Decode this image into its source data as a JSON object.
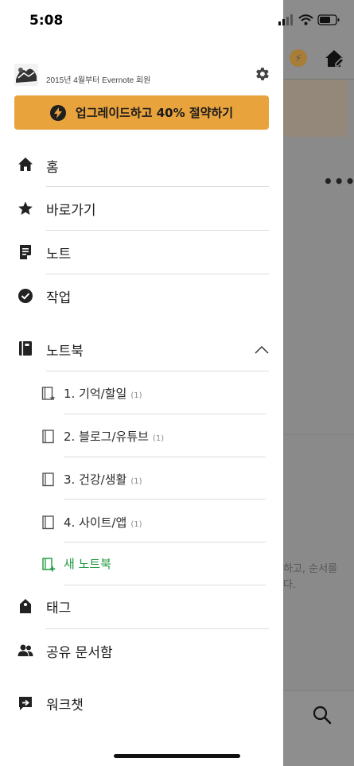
{
  "status": {
    "time": "5:08"
  },
  "profile": {
    "member_since": "2015년 4월부터 Evernote 회원"
  },
  "upgrade": {
    "label": "업그레이드하고 40% 절약하기"
  },
  "nav": {
    "home": "홈",
    "shortcuts": "바로가기",
    "notes": "노트",
    "tasks": "작업",
    "notebooks": "노트북",
    "tags": "태그",
    "shared": "공유 문서함",
    "workchat": "워크챗"
  },
  "notebooks": [
    {
      "label": "1. 기억/할일",
      "count": "(1)"
    },
    {
      "label": "2. 블로그/유튜브",
      "count": "(1)"
    },
    {
      "label": "3. 건강/생활",
      "count": "(1)"
    },
    {
      "label": "4. 사이트/앱",
      "count": "(1)"
    }
  ],
  "new_notebook": "새 노트북",
  "background": {
    "snippet_line1": "하고, 순서를",
    "snippet_line2": "다."
  },
  "colors": {
    "accent": "#e8a33d",
    "green": "#1d9a3e"
  }
}
